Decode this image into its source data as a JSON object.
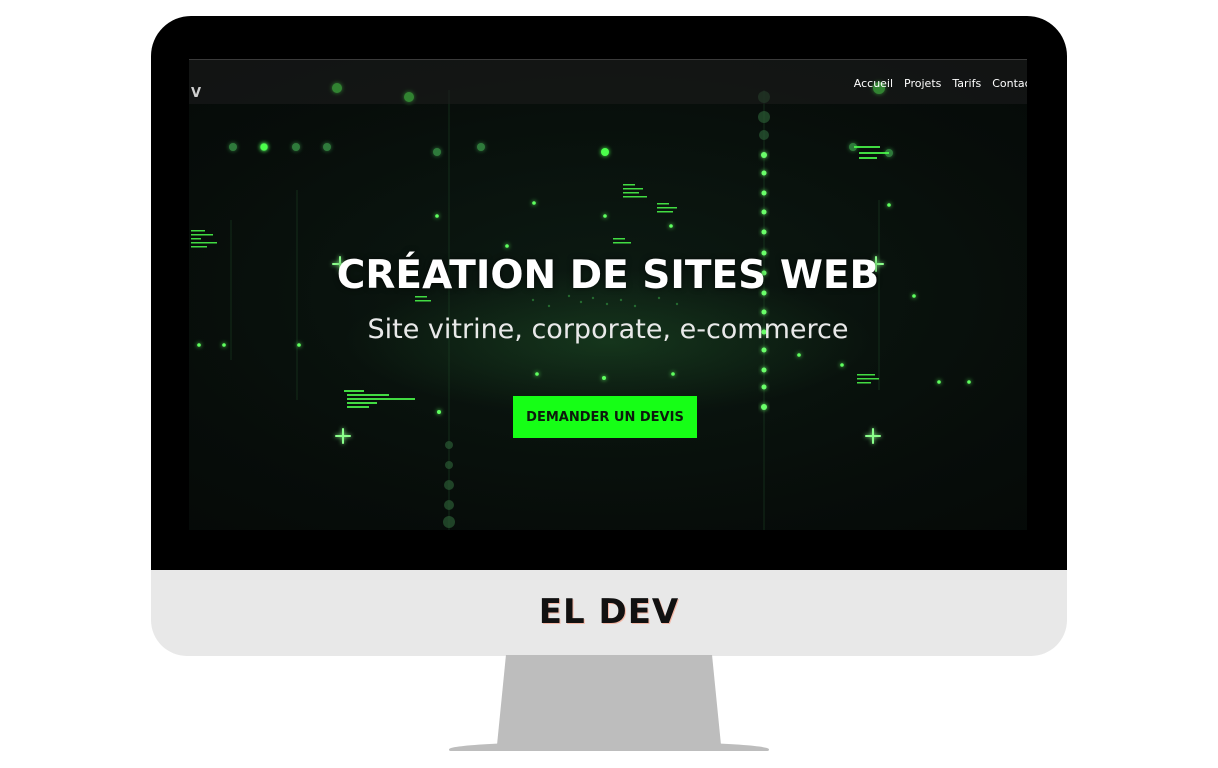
{
  "website": {
    "logo": "V",
    "nav": [
      "Accueil",
      "Projets",
      "Tarifs",
      "Contact"
    ],
    "hero": {
      "title": "CRÉATION DE SITES WEB",
      "subtitle": "Site vitrine, corporate, e-commerce",
      "cta_label": "DEMANDER UN DEVIS"
    }
  },
  "monitor": {
    "brand": "EL DEV"
  },
  "colors": {
    "accent": "#16ff16",
    "screen_bg": "#070d0a",
    "monitor_bezel": "#000000",
    "monitor_chin": "#e8e8e8",
    "stand": "#bdbdbd"
  }
}
